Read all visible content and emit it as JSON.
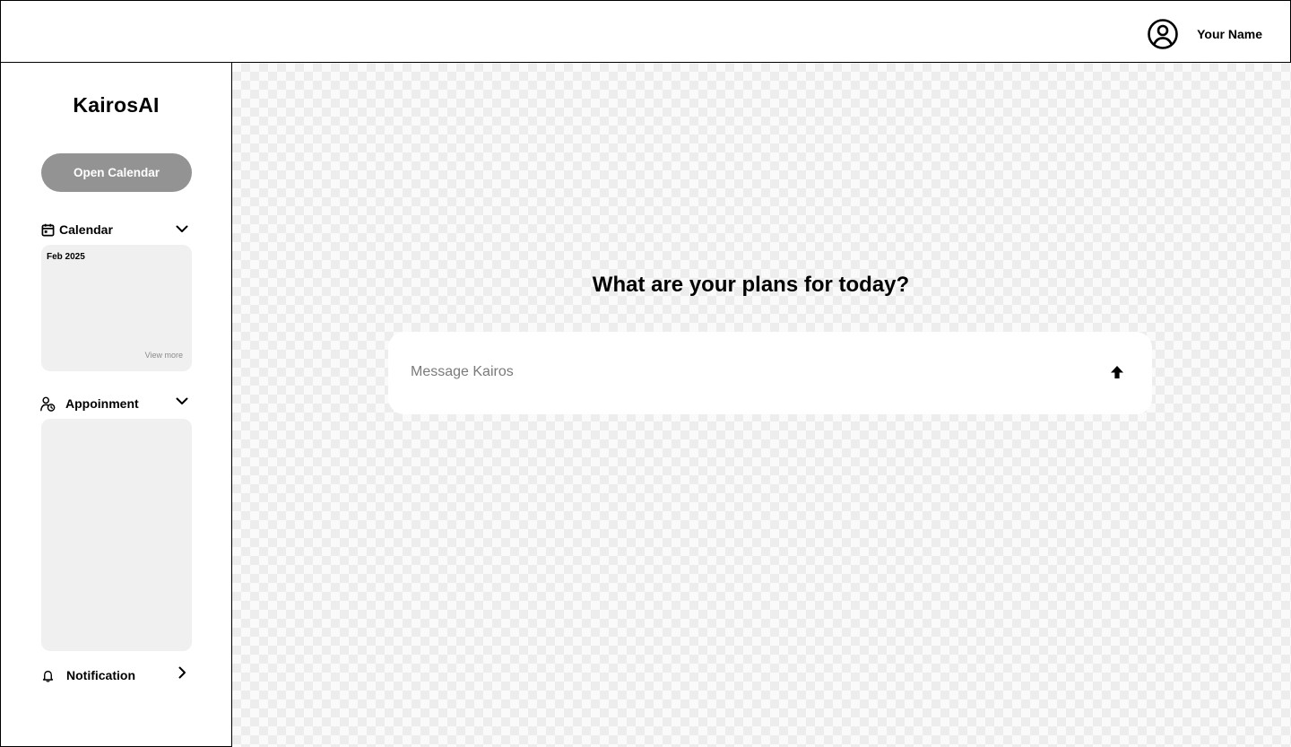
{
  "header": {
    "user_name": "Your Name",
    "avatar_icon": "user-circle-icon"
  },
  "sidebar": {
    "brand": "KairosAI",
    "open_calendar_label": "Open Calendar",
    "calendar": {
      "label": "Calendar",
      "icon": "calendar-icon",
      "month": "Feb 2025",
      "view_more": "View more",
      "expanded": true
    },
    "appointment": {
      "label": "Appoinment",
      "icon": "user-clock-icon",
      "expanded": true
    },
    "notification": {
      "label": "Notification",
      "icon": "bell-icon",
      "expanded": false
    }
  },
  "main": {
    "headline": "What are your plans for today?",
    "message_placeholder": "Message Kairos",
    "send_icon": "arrow-up-icon"
  },
  "colors": {
    "button_bg": "#939393",
    "panel_bg": "#f0f0f0",
    "muted_text": "#8a8a8a"
  }
}
